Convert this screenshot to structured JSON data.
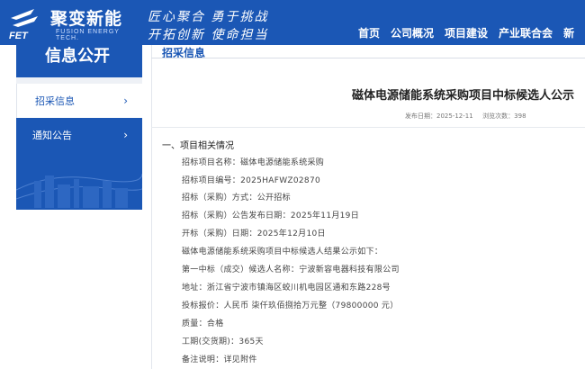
{
  "header": {
    "logo_cn": "聚变新能",
    "logo_en": "FUSION ENERGY TECH.",
    "logo_mark_text": "FET",
    "slogan_line1": "匠心聚合  勇于挑战",
    "slogan_line2": "开拓创新  使命担当",
    "nav": [
      "首页",
      "公司概况",
      "项目建设",
      "产业联合会",
      "新"
    ]
  },
  "sidebar": {
    "title": "信息公开",
    "items": [
      {
        "label": "招采信息",
        "active": true
      },
      {
        "label": "通知公告",
        "active": false
      }
    ]
  },
  "main": {
    "tab": "招采信息",
    "title": "磁体电源储能系统采购项目中标候选人公示",
    "meta": {
      "published": "发布日期：2025-12-11",
      "views": "浏览次数：398"
    },
    "section_heading": "一、项目相关情况",
    "lines": [
      "招标项目名称：磁体电源储能系统采购",
      "招标项目编号：2025HAFWZ02870",
      "招标（采购）方式：公开招标",
      "招标（采购）公告发布日期：2025年11月19日",
      "开标（采购）日期：2025年12月10日",
      "磁体电源储能系统采购项目中标候选人结果公示如下：",
      "第一中标（成交）候选人名称：宁波新容电器科技有限公司",
      "地址：浙江省宁波市镇海区蛟川机电园区通和东路228号",
      "投标报价：人民币 柒仟玖佰捌拾万元整（79800000 元）",
      "质量：合格",
      "工期(交货期)：365天",
      "备注说明：详见附件"
    ]
  },
  "colors": {
    "brand_blue": "#1b57b5",
    "text": "#333333"
  }
}
